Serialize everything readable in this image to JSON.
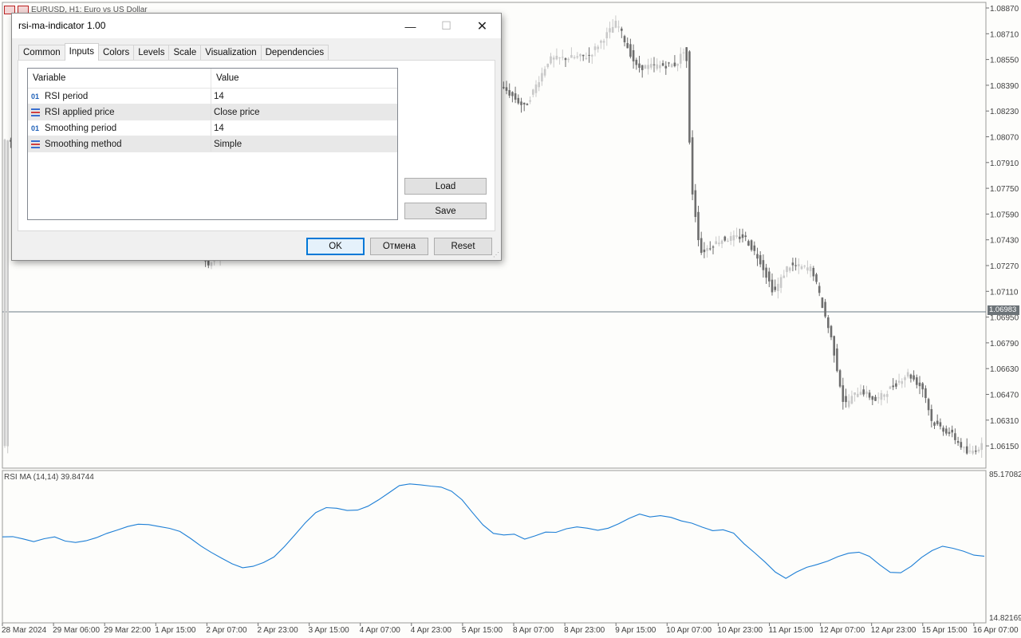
{
  "symbol": {
    "title": "EURUSD, H1:  Euro vs US Dollar"
  },
  "price_axis": {
    "labels": [
      "1.08870",
      "1.08710",
      "1.08550",
      "1.08390",
      "1.08230",
      "1.08070",
      "1.07910",
      "1.07750",
      "1.07590",
      "1.07430",
      "1.07270",
      "1.07110",
      "1.06950",
      "1.06790",
      "1.06630",
      "1.06470",
      "1.06310",
      "1.06150"
    ],
    "current_price": "1.06983"
  },
  "indicator": {
    "title": "RSI MA (14,14) 39.84744",
    "axis_max": "85.17082",
    "axis_min": "14.82169"
  },
  "time_axis": {
    "labels": [
      "28 Mar 2024",
      "29 Mar 06:00",
      "29 Mar 22:00",
      "1 Apr 15:00",
      "2 Apr 07:00",
      "2 Apr 23:00",
      "3 Apr 15:00",
      "4 Apr 07:00",
      "4 Apr 23:00",
      "5 Apr 15:00",
      "8 Apr 07:00",
      "8 Apr 23:00",
      "9 Apr 15:00",
      "10 Apr 07:00",
      "10 Apr 23:00",
      "11 Apr 15:00",
      "12 Apr 07:00",
      "12 Apr 23:00",
      "15 Apr 15:00",
      "16 Apr 07:00"
    ]
  },
  "colors": {
    "candle_bull": "#c9c9c9",
    "candle_bear": "#6e6e6e",
    "rsi_line": "#1e7fd6",
    "selected_button_border": "#0078d7"
  },
  "dialog": {
    "title": "rsi-ma-indicator 1.00",
    "window_buttons": {
      "minimize": "—",
      "maximize": "☐",
      "close": "✕"
    },
    "tabs": [
      {
        "label": "Common",
        "active": false
      },
      {
        "label": "Inputs",
        "active": true
      },
      {
        "label": "Colors",
        "active": false
      },
      {
        "label": "Levels",
        "active": false
      },
      {
        "label": "Scale",
        "active": false
      },
      {
        "label": "Visualization",
        "active": false
      },
      {
        "label": "Dependencies",
        "active": false
      }
    ],
    "grid": {
      "headers": {
        "variable": "Variable",
        "value": "Value"
      },
      "rows": [
        {
          "icon": "01",
          "icon_type": "numeric",
          "variable": "RSI period",
          "value": "14"
        },
        {
          "icon": "enum-icon",
          "icon_type": "enum",
          "variable": "RSI applied price",
          "value": "Close price"
        },
        {
          "icon": "01",
          "icon_type": "numeric",
          "variable": "Smoothing period",
          "value": "14"
        },
        {
          "icon": "enum-icon",
          "icon_type": "enum",
          "variable": "Smoothing method",
          "value": "Simple"
        }
      ]
    },
    "buttons": {
      "load": "Load",
      "save": "Save",
      "ok": "OK",
      "cancel": "Отмена",
      "reset": "Reset"
    }
  },
  "chart_data": {
    "type": "line",
    "title": "RSI MA (14,14) 39.84744",
    "ylim": [
      14.82169,
      85.17082
    ],
    "series": [
      {
        "name": "RSI MA (14,14)",
        "values": [
          55.5,
          55.6,
          54.5,
          53.2,
          54.6,
          55.5,
          53.5,
          52.8,
          53.6,
          55.1,
          57.2,
          58.8,
          60.5,
          61.6,
          61.4,
          60.5,
          59.6,
          58.1,
          54.8,
          51.1,
          48.0,
          45.2,
          42.5,
          40.6,
          41.3,
          43.1,
          45.8,
          50.8,
          56.5,
          62.3,
          67.2,
          69.6,
          69.3,
          68.2,
          68.4,
          70.3,
          73.3,
          76.7,
          80.2,
          81.0,
          80.6,
          80.0,
          79.5,
          77.5,
          73.4,
          67.2,
          61.3,
          57.2,
          56.4,
          56.8,
          54.4,
          56.0,
          57.8,
          57.7,
          59.4,
          60.3,
          59.7,
          58.7,
          59.7,
          61.8,
          64.4,
          66.5,
          65.1,
          65.7,
          64.9,
          63.2,
          62.1,
          60.2,
          58.5,
          58.9,
          57.3,
          52.2,
          47.9,
          43.4,
          38.5,
          35.5,
          38.5,
          40.8,
          42.2,
          43.8,
          46.0,
          47.6,
          48.1,
          46.1,
          42.0,
          38.4,
          38.2,
          41.3,
          45.6,
          48.9,
          51.0,
          50.0,
          48.6,
          46.7,
          46.2
        ]
      }
    ]
  }
}
